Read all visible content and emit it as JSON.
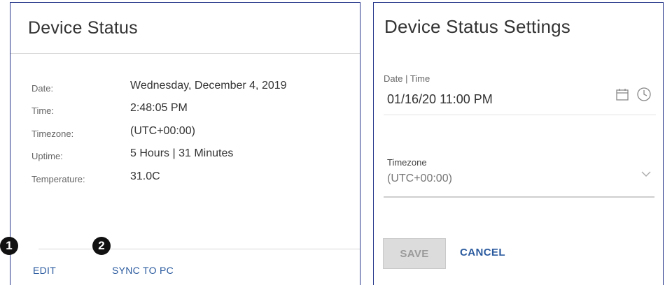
{
  "device_status": {
    "title": "Device Status",
    "rows": [
      {
        "label": "Date:",
        "value": "Wednesday, December 4, 2019"
      },
      {
        "label": "Time:",
        "value": "2:48:05 PM"
      },
      {
        "label": "Timezone:",
        "value": "(UTC+00:00)"
      },
      {
        "label": "Uptime:",
        "value": "5 Hours | 31 Minutes"
      },
      {
        "label": "Temperature:",
        "value": "31.0C"
      }
    ],
    "actions": {
      "edit_label": "EDIT",
      "sync_label": "SYNC TO PC"
    },
    "step_badges": [
      "1",
      "2"
    ]
  },
  "settings": {
    "title": "Device Status Settings",
    "datetime": {
      "label": "Date | Time",
      "value": "01/16/20 11:00 PM",
      "icons": [
        "calendar-icon",
        "clock-icon"
      ]
    },
    "timezone": {
      "label": "Timezone",
      "value": "(UTC+00:00)",
      "icon": "chevron-down-icon"
    },
    "buttons": {
      "save_label": "SAVE",
      "cancel_label": "CANCEL"
    }
  },
  "colors": {
    "panel_border": "#2a3a8c",
    "link": "#2a5a9e",
    "disabled_button_bg": "#dcdcdc"
  }
}
